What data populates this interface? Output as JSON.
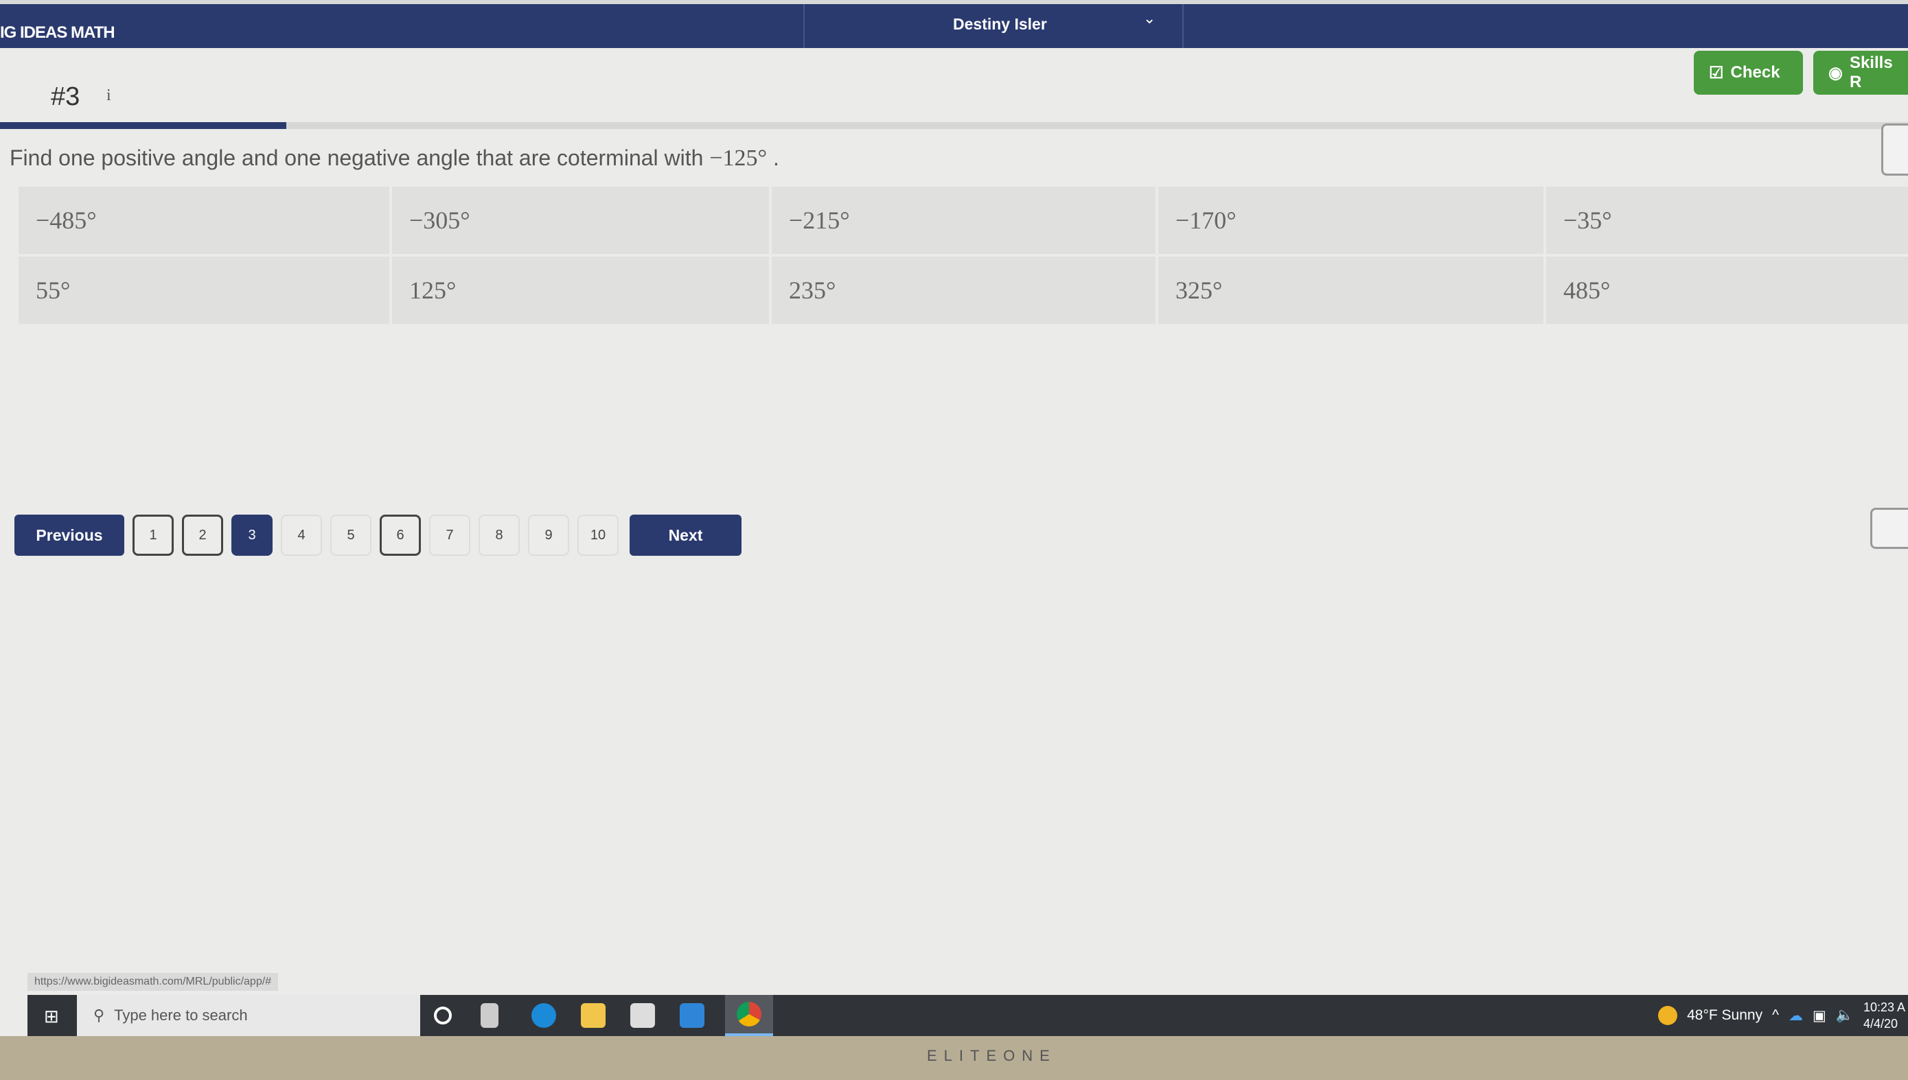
{
  "header": {
    "brand": "IG IDEAS MATH",
    "user": "Destiny Isler"
  },
  "question": {
    "number": "#3",
    "info": "i",
    "text": "Find one positive angle and one negative angle that are coterminal with ",
    "angle": "−125°",
    "end": " .",
    "progress_percent": 15
  },
  "toolbar": {
    "check": "Check",
    "skills": "Skills R"
  },
  "choices": [
    [
      "−485°",
      "−305°",
      "−215°",
      "−170°",
      "−35°"
    ],
    [
      "55°",
      "125°",
      "235°",
      "325°",
      "485°"
    ]
  ],
  "pager": {
    "previous": "Previous",
    "next": "Next",
    "pages": [
      "1",
      "2",
      "3",
      "4",
      "5",
      "6",
      "7",
      "8",
      "9",
      "10"
    ],
    "current": "3",
    "answered": [
      "1",
      "2",
      "6"
    ]
  },
  "status_url": "https://www.bigideasmath.com/MRL/public/app/#",
  "taskbar": {
    "search_placeholder": "Type here to search",
    "weather": "48°F  Sunny",
    "time": "10:23 A",
    "date": "4/4/20"
  },
  "bezel": "ELITEONE",
  "colors": {
    "navy": "#2a3a6e",
    "green": "#4a9a3e"
  }
}
